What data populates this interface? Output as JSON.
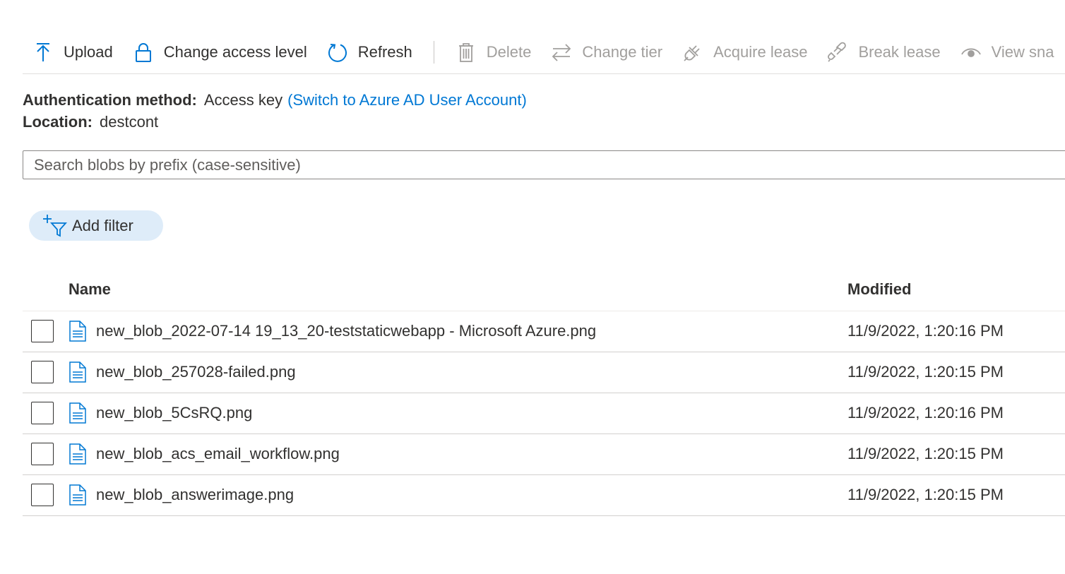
{
  "toolbar": {
    "upload": "Upload",
    "change_access_level": "Change access level",
    "refresh": "Refresh",
    "delete": "Delete",
    "change_tier": "Change tier",
    "acquire_lease": "Acquire lease",
    "break_lease": "Break lease",
    "view_snapshots": "View sna"
  },
  "info": {
    "auth_label": "Authentication method:",
    "auth_value": "Access key",
    "auth_switch_link": "(Switch to Azure AD User Account)",
    "location_label": "Location:",
    "location_value": "destcont"
  },
  "search": {
    "placeholder": "Search blobs by prefix (case-sensitive)",
    "value": ""
  },
  "filter": {
    "add_filter_label": "Add filter"
  },
  "table": {
    "columns": [
      "Name",
      "Modified"
    ],
    "rows": [
      {
        "name": "new_blob_2022-07-14 19_13_20-teststaticwebapp - Microsoft Azure.png",
        "modified": "11/9/2022, 1:20:16 PM"
      },
      {
        "name": "new_blob_257028-failed.png",
        "modified": "11/9/2022, 1:20:15 PM"
      },
      {
        "name": "new_blob_5CsRQ.png",
        "modified": "11/9/2022, 1:20:16 PM"
      },
      {
        "name": "new_blob_acs_email_workflow.png",
        "modified": "11/9/2022, 1:20:15 PM"
      },
      {
        "name": "new_blob_answerimage.png",
        "modified": "11/9/2022, 1:20:15 PM"
      }
    ]
  },
  "colors": {
    "accent": "#0078d4",
    "disabled": "#a19f9d",
    "pill_bg": "#deecf9",
    "text": "#323130"
  },
  "icons": {
    "upload": "upload-icon",
    "lock": "lock-icon",
    "refresh": "refresh-icon",
    "delete": "trash-icon",
    "change_tier": "swap-arrows-icon",
    "acquire_lease": "plug-icon",
    "break_lease": "broken-link-icon",
    "view": "eye-icon",
    "filter": "add-filter-icon",
    "file": "file-icon"
  }
}
